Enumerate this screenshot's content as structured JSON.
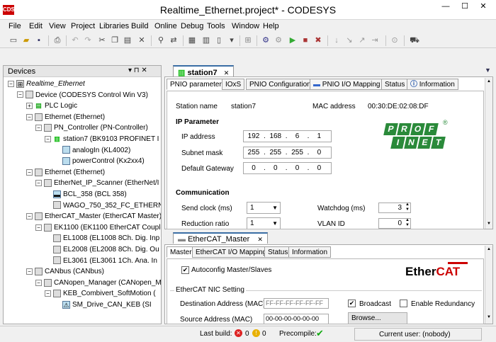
{
  "window": {
    "title": "Realtime_Ethernet.project* - CODESYS",
    "logo": "CDS",
    "min": "—",
    "max": "☐",
    "close": "✕"
  },
  "menu": [
    "File",
    "Edit",
    "View",
    "Project",
    "Libraries",
    "Build",
    "Online",
    "Debug",
    "Tools",
    "Window",
    "Help"
  ],
  "devices": {
    "title": "Devices",
    "pin": "▾  ⊓  ✕",
    "tree": [
      {
        "label": "Realtime_Ethernet",
        "indent": 0,
        "exp": "−",
        "icon": "project-icon",
        "glyph": "⊞",
        "cls": "i-dev",
        "italic": true
      },
      {
        "label": "Device (CODESYS Control Win V3)",
        "indent": 1,
        "exp": "−",
        "icon": "device-icon",
        "glyph": "",
        "cls": "i-dev"
      },
      {
        "label": "PLC Logic",
        "indent": 2,
        "exp": "+",
        "icon": "plc-logic-icon",
        "glyph": "▤",
        "cls": "i-plc"
      },
      {
        "label": "Ethernet (Ethernet)",
        "indent": 2,
        "exp": "−",
        "icon": "ethernet-icon",
        "glyph": "",
        "cls": "i-dev"
      },
      {
        "label": "PN_Controller (PN-Controller)",
        "indent": 3,
        "exp": "−",
        "icon": "pn-controller-icon",
        "glyph": "",
        "cls": "i-dev"
      },
      {
        "label": "station7 (BK9103 PROFINET I",
        "indent": 4,
        "exp": "−",
        "icon": "station-icon",
        "glyph": "▥",
        "cls": "i-grn"
      },
      {
        "label": "analogIn (KL4002)",
        "indent": 5,
        "exp": "",
        "icon": "io-module-icon",
        "glyph": "",
        "cls": "i-io"
      },
      {
        "label": "powerControl (Kx2xx4)",
        "indent": 5,
        "exp": "",
        "icon": "io-module-icon",
        "glyph": "",
        "cls": "i-io"
      },
      {
        "label": "Ethernet (Ethernet)",
        "indent": 2,
        "exp": "−",
        "icon": "ethernet-icon",
        "glyph": "",
        "cls": "i-dev"
      },
      {
        "label": "EtherNet_IP_Scanner (EtherNet/I",
        "indent": 3,
        "exp": "−",
        "icon": "scanner-icon",
        "glyph": "",
        "cls": "i-dev"
      },
      {
        "label": "BCL_358 (BCL 358)",
        "indent": 4,
        "exp": "",
        "icon": "bcl-icon",
        "glyph": "▬",
        "cls": "i-io"
      },
      {
        "label": "WAGO_750_352_FC_ETHERN",
        "indent": 4,
        "exp": "",
        "icon": "wago-icon",
        "glyph": "",
        "cls": "i-dev"
      },
      {
        "label": "EtherCAT_Master (EtherCAT Master)",
        "indent": 2,
        "exp": "−",
        "icon": "ethercat-master-icon",
        "glyph": "",
        "cls": "i-dev"
      },
      {
        "label": "EK1100 (EK1100 EtherCAT Couple",
        "indent": 3,
        "exp": "−",
        "icon": "coupler-icon",
        "glyph": "",
        "cls": "i-dev"
      },
      {
        "label": "EL1008 (EL1008 8Ch. Dig. Inp",
        "indent": 4,
        "exp": "",
        "icon": "terminal-icon",
        "glyph": "",
        "cls": "i-dev"
      },
      {
        "label": "EL2008 (EL2008 8Ch. Dig. Ou",
        "indent": 4,
        "exp": "",
        "icon": "terminal-icon",
        "glyph": "",
        "cls": "i-dev"
      },
      {
        "label": "EL3061 (EL3061 1Ch. Ana. In",
        "indent": 4,
        "exp": "",
        "icon": "terminal-icon",
        "glyph": "",
        "cls": "i-dev"
      },
      {
        "label": "CANbus (CANbus)",
        "indent": 2,
        "exp": "−",
        "icon": "canbus-icon",
        "glyph": "",
        "cls": "i-dev"
      },
      {
        "label": "CANopen_Manager (CANopen_M",
        "indent": 3,
        "exp": "−",
        "icon": "canopen-icon",
        "glyph": "",
        "cls": "i-dev"
      },
      {
        "label": "KEB_Combivert_SoftMotion (",
        "indent": 4,
        "exp": "−",
        "icon": "drive-icon",
        "glyph": "",
        "cls": "i-dev"
      },
      {
        "label": "SM_Drive_CAN_KEB (SI",
        "indent": 5,
        "exp": "",
        "icon": "sm-drive-icon",
        "glyph": "⚠",
        "cls": "i-io"
      }
    ]
  },
  "editor1": {
    "tab": "station7",
    "tab_close": "✕",
    "subtabs": [
      "PNIO parameters",
      "IOxS",
      "PNIO Configuration",
      "PNIO I/O Mapping",
      "Status",
      "Information"
    ],
    "station_name_label": "Station name",
    "station_name": "station7",
    "mac_label": "MAC address",
    "mac": "00:30:DE:02:08:DF",
    "ip_header": "IP Parameter",
    "ip_label": "IP address",
    "ip": [
      "192",
      "168",
      "6",
      "1"
    ],
    "mask_label": "Subnet mask",
    "mask": [
      "255",
      "255",
      "255",
      "0"
    ],
    "gw_label": "Default Gateway",
    "gw": [
      "0",
      "0",
      "0",
      "0"
    ],
    "comm_header": "Communication",
    "send_clock_label": "Send clock (ms)",
    "send_clock": "1",
    "reduction_label": "Reduction ratio",
    "reduction": "1",
    "watchdog_label": "Watchdog (ms)",
    "watchdog": "3",
    "vlan_label": "VLAN ID",
    "vlan": "0",
    "logo": [
      "P",
      "R",
      "O",
      "F",
      "I",
      "N",
      "E",
      "T"
    ],
    "reg": "®"
  },
  "editor2": {
    "tab": "EtherCAT_Master",
    "tab_close": "✕",
    "subtabs": [
      "Master",
      "EtherCAT I/O Mapping",
      "Status",
      "Information"
    ],
    "autoconfig": "Autoconfig Master/Slaves",
    "nic_header": "EtherCAT NIC Setting",
    "dest_label": "Destination Address (MAC)",
    "dest": "FF-FF-FF-FF-FF-FF",
    "broadcast": "Broadcast",
    "redundancy": "Enable Redundancy",
    "src_label": "Source Address (MAC)",
    "src": "00-00-00-00-00-00",
    "browse": "Browse...",
    "logo_left": "Ether",
    "logo_right": "CAT"
  },
  "status": {
    "last_build": "Last build:",
    "errors": "0",
    "warnings": "0",
    "precompile": "Precompile:",
    "precompile_ok": "✔",
    "user": "Current user: (nobody)"
  }
}
